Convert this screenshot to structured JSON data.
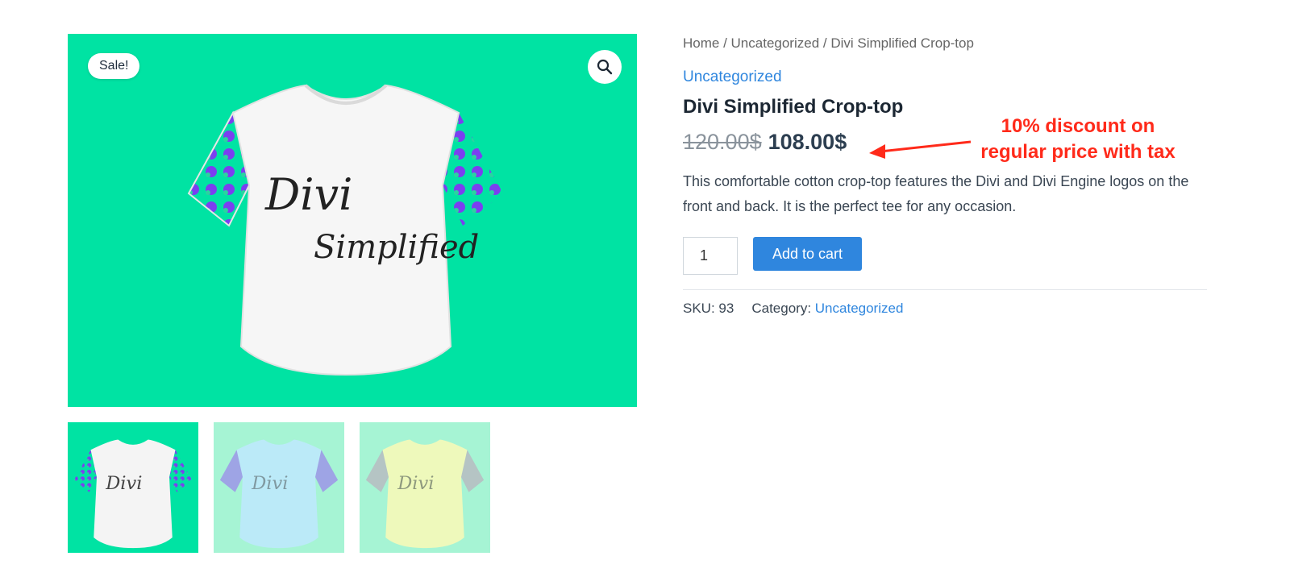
{
  "gallery": {
    "sale_badge": "Sale!",
    "zoom_icon": "magnifier-icon",
    "main_image": {
      "print_line1": "Divi",
      "print_line2": "Simplified",
      "body_color": "#f6f6f6",
      "pattern_color": "#7b3ff0",
      "bg_color": "#00e3a3"
    },
    "thumbnails": [
      {
        "body_color": "#f4f4f4",
        "pattern_color": "#7b3ff0"
      },
      {
        "body_color": "#bfe9ff",
        "pattern_color": "#7b6ee0"
      },
      {
        "body_color": "#fbfbb7",
        "pattern_color": "#9aa0a8"
      }
    ]
  },
  "summary": {
    "breadcrumb": {
      "home": "Home",
      "sep1": " / ",
      "cat": "Uncategorized",
      "sep2": " / ",
      "current": "Divi Simplified Crop-top"
    },
    "category_link": "Uncategorized",
    "title": "Divi Simplified Crop-top",
    "price_old": "120.00$",
    "price_new": "108.00$",
    "description": "This comfortable cotton crop-top features the Divi and Divi Engine logos on the front and back. It is the perfect tee for any occasion.",
    "quantity": "1",
    "add_to_cart": "Add to cart",
    "meta": {
      "sku_label": "SKU:",
      "sku_value": "93",
      "category_label": "Category:",
      "category_value": "Uncategorized"
    }
  },
  "annotation": {
    "line1": "10% discount on",
    "line2": "regular price with tax",
    "color": "#ff2a1a"
  },
  "colors": {
    "accent": "#2f86de",
    "brand_green": "#00e3a3"
  }
}
